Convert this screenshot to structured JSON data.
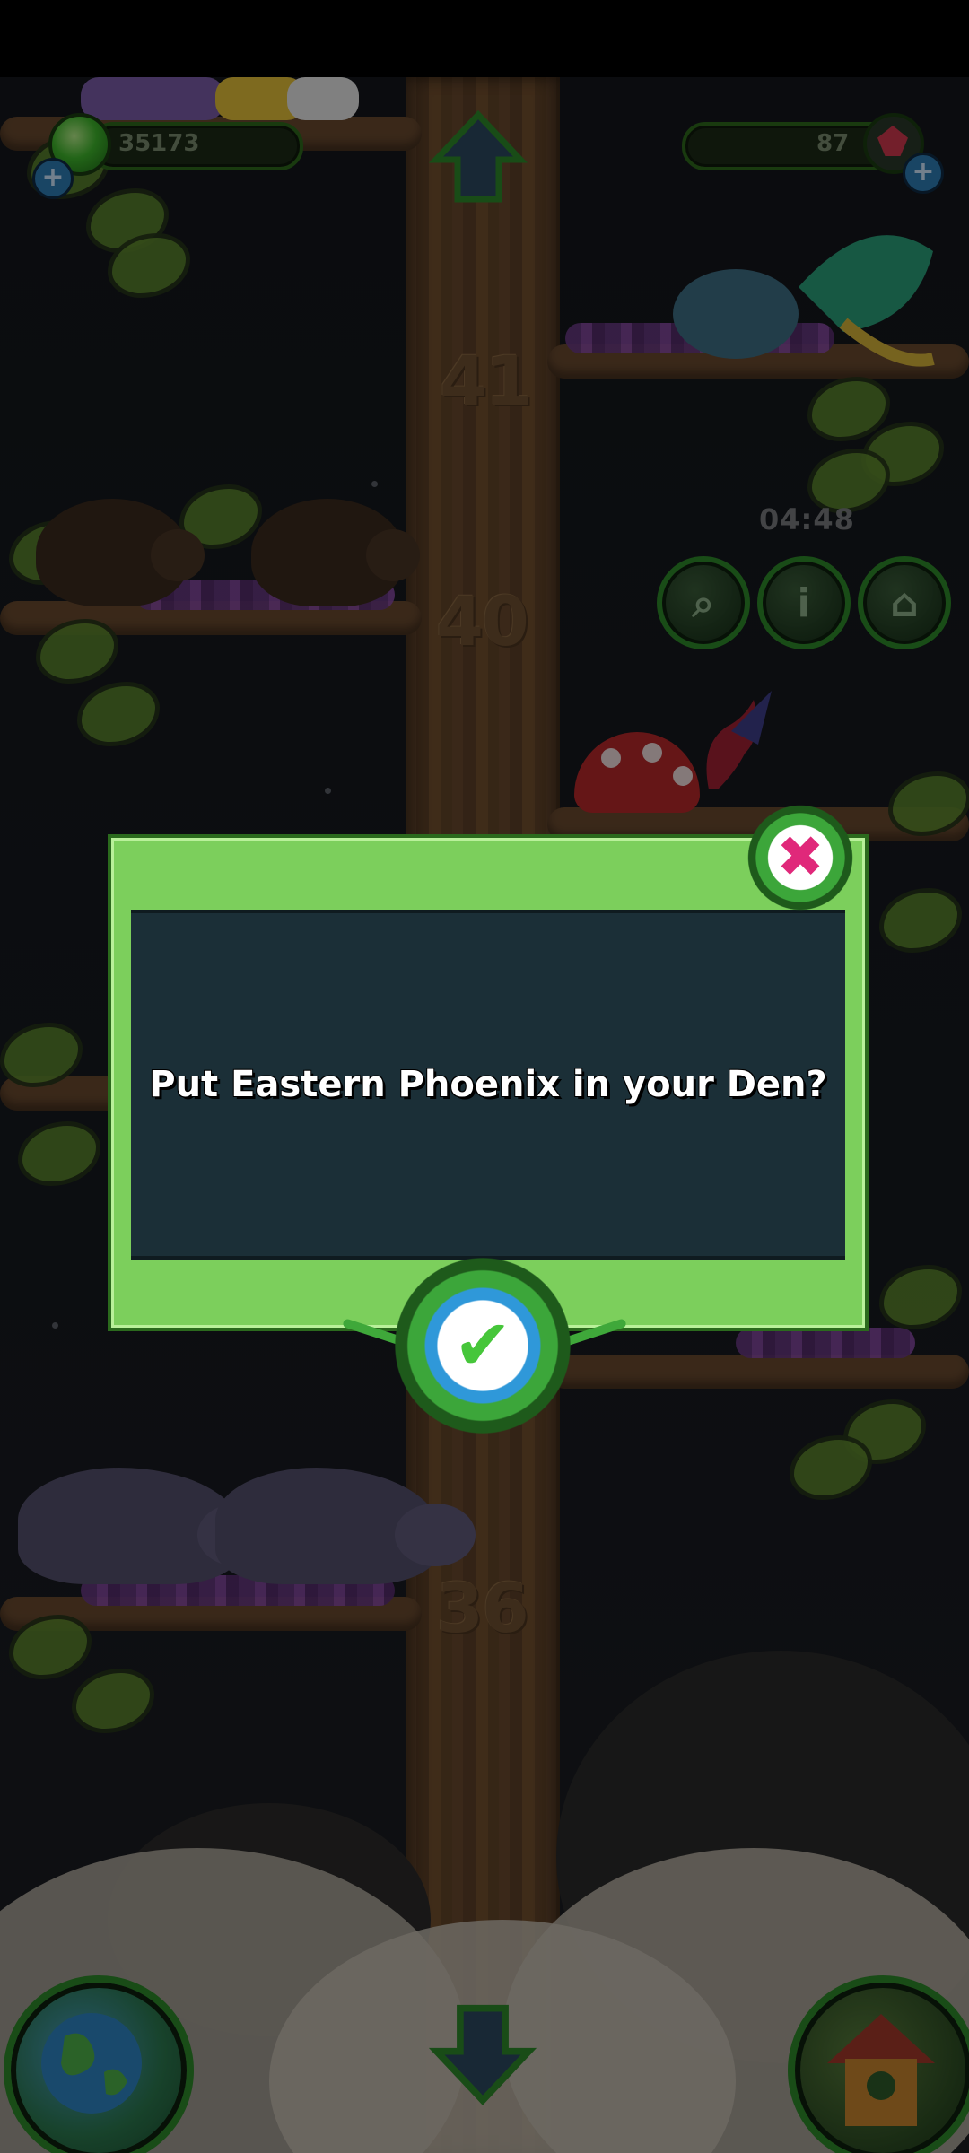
{
  "hud": {
    "coins": "35173",
    "gems": "87",
    "timer": "04:48"
  },
  "tree": {
    "level_numbers": [
      "41",
      "40",
      "36"
    ]
  },
  "dialog": {
    "message": "Put Eastern Phoenix in your Den?"
  },
  "icons": {
    "coin": "leaf-coin-icon",
    "gem": "gem-icon",
    "add": "plus-icon",
    "up": "arrow-up-icon",
    "down": "arrow-down-icon",
    "net": "net-icon",
    "info": "info-icon",
    "den": "den-icon",
    "globe": "globe-icon",
    "house": "house-icon",
    "close": "close-icon",
    "confirm": "checkmark-icon"
  },
  "colors": {
    "dialog_frame": "#7ccf5c",
    "dialog_panel": "#1b2f37",
    "close_accent": "#e0287a",
    "confirm_accent": "#46c63a"
  }
}
